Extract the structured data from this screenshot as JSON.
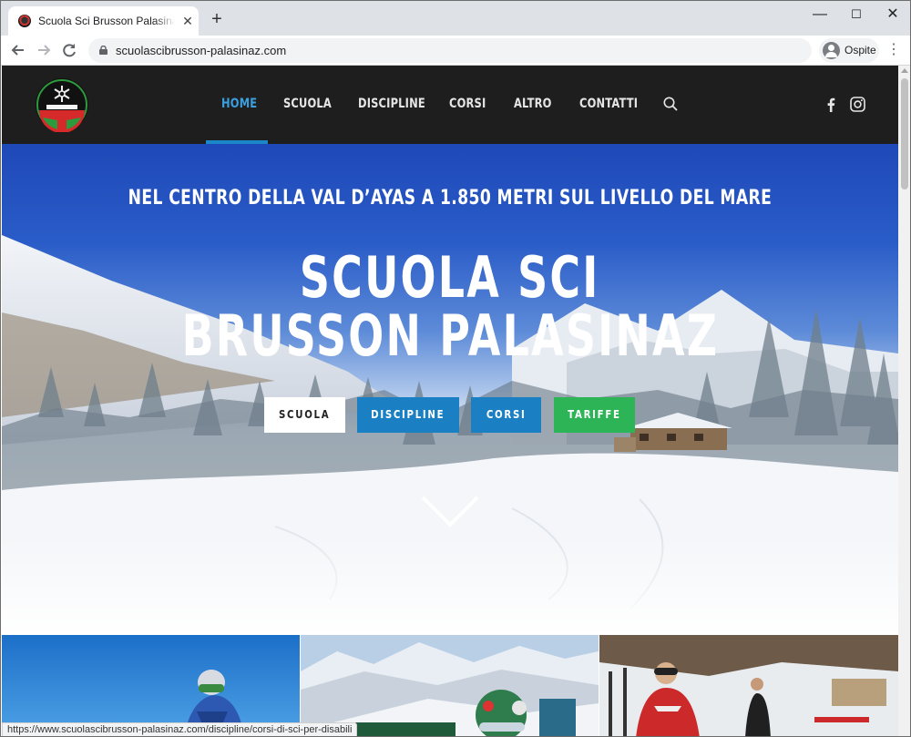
{
  "browser": {
    "tab_title": "Scuola Sci Brusson Palasinaz nel cuore della Val d'Ayas",
    "tab_close": "✕",
    "new_tab": "+",
    "url": "scuolascibrusson-palasinaz.com",
    "profile_label": "Ospite",
    "status_url": "https://www.scuolascibrusson-palasinaz.com/discipline/corsi-di-sci-per-disabili",
    "window_controls": {
      "minimize": "—",
      "maximize": "☐",
      "close": "✕"
    }
  },
  "site": {
    "nav": [
      {
        "label": "HOME",
        "active": true
      },
      {
        "label": "SCUOLA"
      },
      {
        "label": "DISCIPLINE"
      },
      {
        "label": "CORSI"
      },
      {
        "label": "ALTRO"
      },
      {
        "label": "CONTATTI"
      }
    ],
    "accent_color": "#1b87c9",
    "social_icons": [
      "facebook-icon",
      "instagram-icon"
    ]
  },
  "hero": {
    "subtitle": "NEL CENTRO DELLA VAL D’AYAS A 1.850 METRI SUL LIVELLO DEL MARE",
    "title_line1": "SCUOLA SCI",
    "title_line2": "BRUSSON PALASINAZ",
    "buttons": [
      {
        "label": "SCUOLA",
        "color": "#ffffff"
      },
      {
        "label": "DISCIPLINE",
        "color": "#1b7fc4"
      },
      {
        "label": "CORSI",
        "color": "#1b7fc4"
      },
      {
        "label": "TARIFFE",
        "color": "#2db457"
      }
    ]
  }
}
